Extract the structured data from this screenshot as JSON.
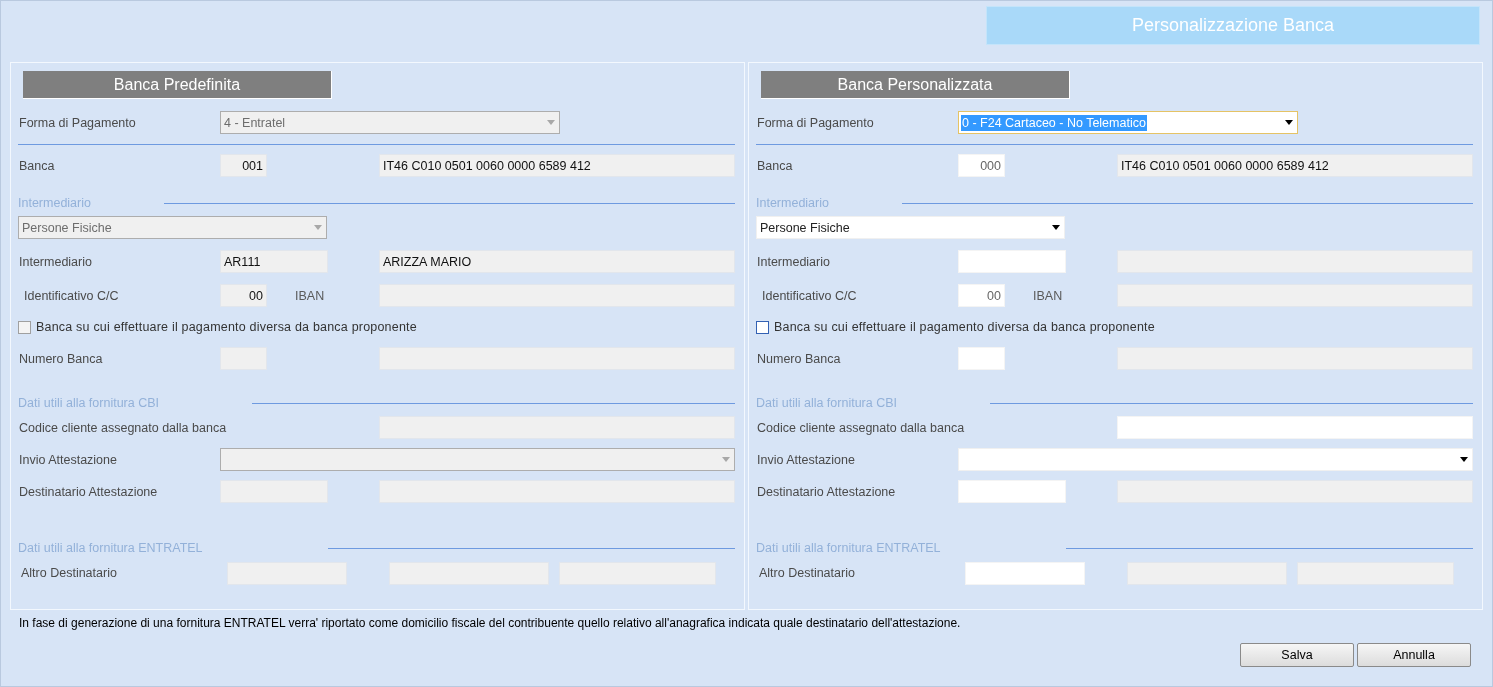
{
  "header": {
    "title": "Personalizzazione Banca"
  },
  "panels": [
    {
      "title": "Banca Predefinita",
      "rows": [
        {
          "kind": "select",
          "label": "Forma di Pagamento",
          "value": "4 - Entratel",
          "disabled": true,
          "focused": false
        },
        {
          "kind": "rule"
        },
        {
          "kind": "pair",
          "label": "Banca",
          "fields": [
            {
              "kind": "short",
              "value": "001",
              "disabled": true
            },
            {
              "kind": "long",
              "value": "IT46 C010 0501 0060 0000 6589 412",
              "disabled": true
            }
          ]
        },
        {
          "kind": "section",
          "title": "Intermediario"
        },
        {
          "kind": "select-bare",
          "value": "Persone Fisiche",
          "disabled": true
        },
        {
          "kind": "pair",
          "label": "Intermediario",
          "fields": [
            {
              "kind": "medium",
              "value": "AR111",
              "disabled": true
            },
            {
              "kind": "long",
              "value": "ARIZZA MARIO",
              "disabled": true
            }
          ]
        },
        {
          "kind": "pair",
          "label": "Identificativo C/C",
          "side_label": "IBAN",
          "fields": [
            {
              "kind": "short",
              "value": "00",
              "disabled": true
            },
            {
              "kind": "long",
              "disabled": true
            }
          ]
        },
        {
          "kind": "check",
          "label": "Banca su cui effettuare il pagamento diversa da banca proponente",
          "checked": false,
          "disabled": true
        },
        {
          "kind": "pair",
          "label": "Numero Banca",
          "fields": [
            {
              "kind": "short",
              "disabled": true
            },
            {
              "kind": "long",
              "disabled": true
            }
          ]
        },
        {
          "kind": "section",
          "title": "Dati utili alla fornitura CBI"
        },
        {
          "kind": "pair",
          "label": "Codice cliente assegnato dalla banca",
          "fields": [
            {
              "kind": "long",
              "disabled": true
            }
          ]
        },
        {
          "kind": "select-wide",
          "label": "Invio Attestazione",
          "disabled": true
        },
        {
          "kind": "pair",
          "label": "Destinatario Attestazione",
          "fields": [
            {
              "kind": "medium",
              "disabled": true
            },
            {
              "kind": "long",
              "disabled": true
            }
          ]
        },
        {
          "kind": "section",
          "title": "Dati utili alla fornitura ENTRATEL"
        },
        {
          "kind": "triple",
          "label": "Altro Destinatario",
          "fields": [
            {
              "disabled": true
            },
            {
              "disabled": true
            },
            {
              "disabled": true
            }
          ]
        }
      ]
    },
    {
      "title": "Banca Personalizzata",
      "rows": [
        {
          "kind": "select",
          "label": "Forma di Pagamento",
          "value": "0 - F24 Cartaceo - No Telematico",
          "disabled": false,
          "focused": true
        },
        {
          "kind": "rule"
        },
        {
          "kind": "pair",
          "label": "Banca",
          "fields": [
            {
              "kind": "short",
              "value": "000",
              "disabled": false
            },
            {
              "kind": "long",
              "value": "IT46 C010 0501 0060 0000 6589 412",
              "disabled": true
            }
          ]
        },
        {
          "kind": "section",
          "title": "Intermediario"
        },
        {
          "kind": "select-bare",
          "value": "Persone Fisiche",
          "disabled": false
        },
        {
          "kind": "pair",
          "label": "Intermediario",
          "fields": [
            {
              "kind": "medium",
              "disabled": false
            },
            {
              "kind": "long",
              "disabled": true
            }
          ]
        },
        {
          "kind": "pair",
          "label": "Identificativo C/C",
          "side_label": "IBAN",
          "fields": [
            {
              "kind": "short",
              "value": "00",
              "disabled": false
            },
            {
              "kind": "long",
              "disabled": true
            }
          ]
        },
        {
          "kind": "check",
          "label": "Banca su cui effettuare il pagamento diversa da banca proponente",
          "checked": false,
          "disabled": false
        },
        {
          "kind": "pair",
          "label": "Numero Banca",
          "fields": [
            {
              "kind": "short",
              "disabled": false
            },
            {
              "kind": "long",
              "disabled": true
            }
          ]
        },
        {
          "kind": "section",
          "title": "Dati utili alla fornitura CBI"
        },
        {
          "kind": "pair",
          "label": "Codice cliente assegnato dalla banca",
          "fields": [
            {
              "kind": "long",
              "disabled": false
            }
          ]
        },
        {
          "kind": "select-wide",
          "label": "Invio Attestazione",
          "disabled": false
        },
        {
          "kind": "pair",
          "label": "Destinatario Attestazione",
          "fields": [
            {
              "kind": "medium",
              "disabled": false
            },
            {
              "kind": "long",
              "disabled": true
            }
          ]
        },
        {
          "kind": "section",
          "title": "Dati utili alla fornitura ENTRATEL"
        },
        {
          "kind": "triple",
          "label": "Altro Destinatario",
          "fields": [
            {
              "disabled": false
            },
            {
              "disabled": true
            },
            {
              "disabled": true
            }
          ]
        }
      ]
    }
  ],
  "note": "In fase di generazione di una fornitura ENTRATEL verra' riportato come domicilio fiscale del contribuente quello relativo all'anagrafica indicata quale destinatario dell'attestazione.",
  "buttons": [
    {
      "label": "Salva"
    },
    {
      "label": "Annulla"
    }
  ]
}
